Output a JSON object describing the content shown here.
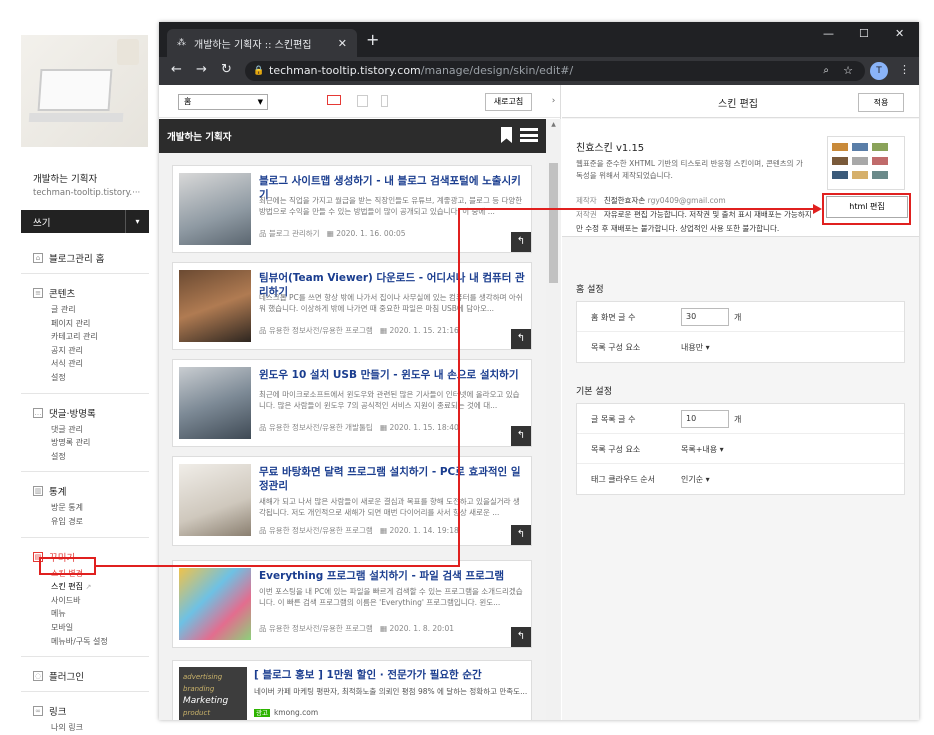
{
  "sidebar": {
    "blog_name": "개발하는 기획자",
    "blog_url": "techman-tooltip.tistory.···",
    "write_label": "쓰기",
    "sections": [
      {
        "title": "블로그관리 홈",
        "items": []
      },
      {
        "title": "콘텐츠",
        "items": [
          "글 관리",
          "페이지 관리",
          "카테고리 관리",
          "공지 관리",
          "서식 관리",
          "설정"
        ]
      },
      {
        "title": "댓글·방명록",
        "items": [
          "댓글 관리",
          "방명록 관리",
          "설정"
        ]
      },
      {
        "title": "통계",
        "items": [
          "방문 통계",
          "유입 경로"
        ]
      },
      {
        "title": "꾸미기",
        "items": [
          "스킨 변경",
          "스킨 편집",
          "사이드바",
          "메뉴",
          "모바일",
          "메뉴바/구독 설정"
        ]
      },
      {
        "title": "플러그인",
        "items": []
      },
      {
        "title": "링크",
        "items": [
          "나의 링크"
        ]
      }
    ]
  },
  "browser": {
    "tab_title": "개발하는 기획자 :: 스킨편집",
    "url_host": "techman-tooltip.tistory.com",
    "url_path": "/manage/design/skin/edit#/",
    "profile_initial": "T"
  },
  "editor": {
    "page_select": "홈",
    "refresh_label": "새로고침",
    "preview_blog_title": "개발하는 기획자",
    "posts": [
      {
        "title": "블로그 사이트맵 생성하기 - 내 블로그 검색포털에 노출시키기",
        "excerpt": "최근에는 직업을 가지고 월급을 받는 직장인들도 유튜브, 계좋광고, 블로그 등 다양한 방법으로 수익을 만들 수 있는 방법들이 많이 공개되고 있습니다. 이 중에 ...",
        "category": "블로그 관리하기",
        "date": "2020. 1. 16. 00:05"
      },
      {
        "title": "팀뷰어(Team Viewer) 다운로드 - 어디서나 내 컴퓨터 관리하기",
        "excerpt": "데스크톱 PC를 쓰면 항상 밖에 나가서 집이나 사무실에 있는 컴퓨터를 생각하며 아쉬워 했습니다. 이상하게 밖에 나가면 때 중요한 파일은 마침 USB에 담아오...",
        "category": "유용한 정보사전/유용한 프로그램",
        "date": "2020. 1. 15. 21:16"
      },
      {
        "title": "윈도우 10 설치 USB 만들기 - 윈도우 내 손으로 설치하기",
        "excerpt": "최근에 마이크로소프트에서 윈도우와 관련된 많은 기사들이 인터넷에 올라오고 있습니다. 많은 사람들이 윈도우 7의 공식적인 서비스 지원이 종료되는 것에 대...",
        "category": "유용한 정보사전/유용한 개발툴팁",
        "date": "2020. 1. 15. 18:40"
      },
      {
        "title": "무료 바탕화면 달력 프로그램 설치하기 - PC로 효과적인 일정관리",
        "excerpt": "새해가 되고 나서 많은 사람들이 새로운 결심과 목표를 향해 도전하고 있을실거라 생각됩니다. 저도 개인적으로 새해가 되면 매번 다이어리를 사서 항상 새로운 ...",
        "category": "유용한 정보사전/유용한 프로그램",
        "date": "2020. 1. 14. 19:18"
      },
      {
        "title": "Everything 프로그램 설치하기 - 파일 검색 프로그램",
        "excerpt": "이번 포스팅을 내 PC에 있는 파일을 빠르게 검색할 수 있는 프로그램을 소개드리겠습니다. 이 빠른 검색 프로그램의 이름은 'Everything' 프로그램입니다. 윈도...",
        "category": "유용한 정보사전/유용한 프로그램",
        "date": "2020. 1. 8. 20:01"
      }
    ],
    "ad": {
      "title": "[ 블로그 홍보 ] 1만원 할인 · 전문가가 필요한 순간",
      "excerpt": "네이버 카페 마케팅 평판자, 최적화노출 의뢰인 평점 98% 에 달하는 정확하고 만족도...",
      "source": "kmong.com",
      "badge": "광고",
      "thumb_words": [
        "advertising",
        "branding",
        "Marketing",
        "product"
      ]
    }
  },
  "skin_panel": {
    "title": "스킨 편집",
    "apply_label": "적용",
    "skin_name": "친효스킨 v1.15",
    "skin_desc": "웹표준을 준수한 XHTML 기반의 티스토리 반응형 스킨이며, 콘텐츠의 가독성을 위해서 제작되었습니다.",
    "maker_label": "제작자",
    "maker_name": "친절한효자손",
    "maker_email": "rgy0409@gmail.com",
    "copyright_label": "저작권",
    "copyright_text": "자유로운 편집 가능합니다. 저작권 및 출처 표시 재배포는 가능하지만 수정 후 재배포는 불가합니다. 상업적인 사용 또한 불가합니다.",
    "html_edit_label": "html 편집",
    "home_settings_title": "홈 설정",
    "home_rows": [
      {
        "label": "홈 화면 글 수",
        "value": "30",
        "unit": "개"
      },
      {
        "label": "목록 구성 요소",
        "dropdown": "내용만 ▾"
      }
    ],
    "basic_settings_title": "기본 설정",
    "basic_rows": [
      {
        "label": "글 목록 글 수",
        "value": "10",
        "unit": "개"
      },
      {
        "label": "목록 구성 요소",
        "dropdown": "목록+내용 ▾"
      },
      {
        "label": "태그 클라우드 순서",
        "dropdown": "인기순 ▾"
      }
    ]
  },
  "colors": {
    "highlight": "#e0201f",
    "link": "#1a3d8f"
  }
}
